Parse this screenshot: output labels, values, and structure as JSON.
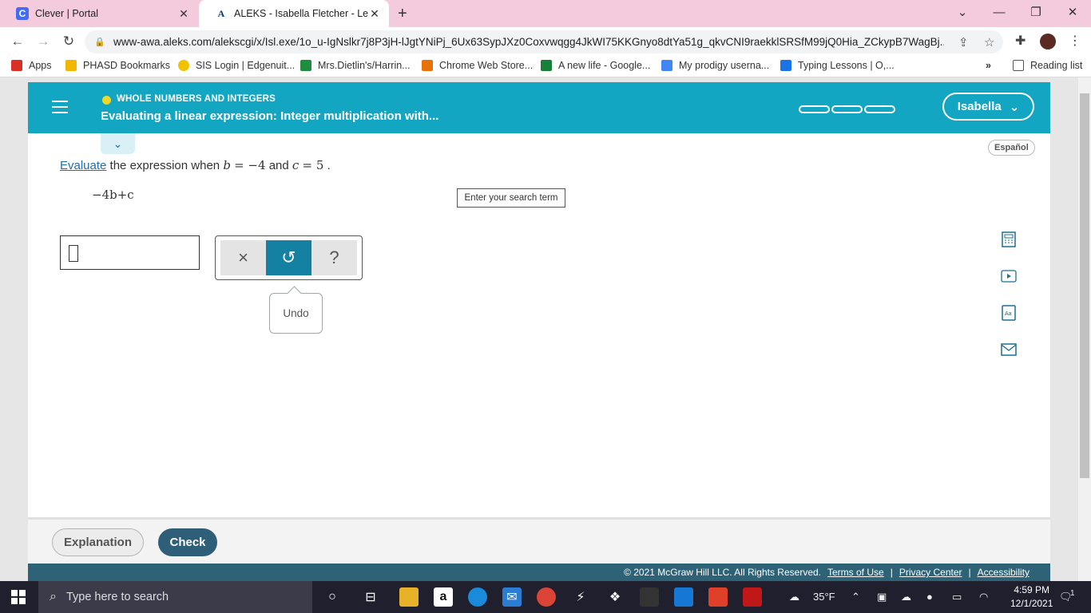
{
  "browser": {
    "tabs": [
      {
        "title": "Clever | Portal",
        "favicon": "clever-icon",
        "active": false
      },
      {
        "title": "ALEKS - Isabella Fletcher - Learn",
        "favicon": "aleks-icon",
        "active": true
      }
    ],
    "url": "www-awa.aleks.com/alekscgi/x/Isl.exe/1o_u-IgNslkr7j8P3jH-lJgtYNiPj_6Ux63SypJXz0Coxvwqgg4JkWI75KKGnyo8dtYa51g_qkvCNI9raekklSRSfM99jQ0Hia_ZCkypB7WagBj...",
    "bookmarks": [
      {
        "label": "Apps",
        "icon": "apps-grid-icon",
        "color": "#d93025"
      },
      {
        "label": "PHASD Bookmarks",
        "icon": "folder-icon",
        "color": "#f2b600"
      },
      {
        "label": "SIS Login | Edgenuit...",
        "icon": "bulb-icon",
        "color": "#f2c200"
      },
      {
        "label": "Mrs.Dietlin's/Harrin...",
        "icon": "classroom-icon",
        "color": "#1e8e3e"
      },
      {
        "label": "Chrome Web Store...",
        "icon": "webstore-icon",
        "color": "#e8710a"
      },
      {
        "label": "A new life - Google...",
        "icon": "drive-icon",
        "color": "#188038"
      },
      {
        "label": "My prodigy userna...",
        "icon": "docs-icon",
        "color": "#4285f4"
      },
      {
        "label": "Typing Lessons | O,...",
        "icon": "typing-icon",
        "color": "#1a73e8"
      }
    ],
    "more": "»",
    "reading_list": "Reading list"
  },
  "aleks": {
    "topic": "WHOLE NUMBERS AND INTEGERS",
    "lesson_title": "Evaluating a linear expression: Integer multiplication with...",
    "user_name": "Isabella",
    "espanol": "Español",
    "question": {
      "link_word": "Evaluate",
      "text1": "the expression when",
      "var1": "b",
      "eq1": "= −4",
      "and": "and",
      "var2": "c",
      "eq2": "= 5",
      "period": "."
    },
    "expression": "−4b+c",
    "search_term": "Enter your search term",
    "tools": {
      "clear": "×",
      "undo": "↺",
      "help": "?"
    },
    "tooltip": "Undo",
    "buttons": {
      "explanation": "Explanation",
      "check": "Check"
    },
    "footer": {
      "copyright": "© 2021 McGraw Hill LLC. All Rights Reserved.",
      "terms": "Terms of Use",
      "privacy": "Privacy Center",
      "accessibility": "Accessibility",
      "sep": "|"
    },
    "accent": "#13a6c3"
  },
  "taskbar": {
    "search_placeholder": "Type here to search",
    "weather": "35°F",
    "time": "4:59 PM",
    "date": "12/1/2021",
    "notifications": "1"
  }
}
